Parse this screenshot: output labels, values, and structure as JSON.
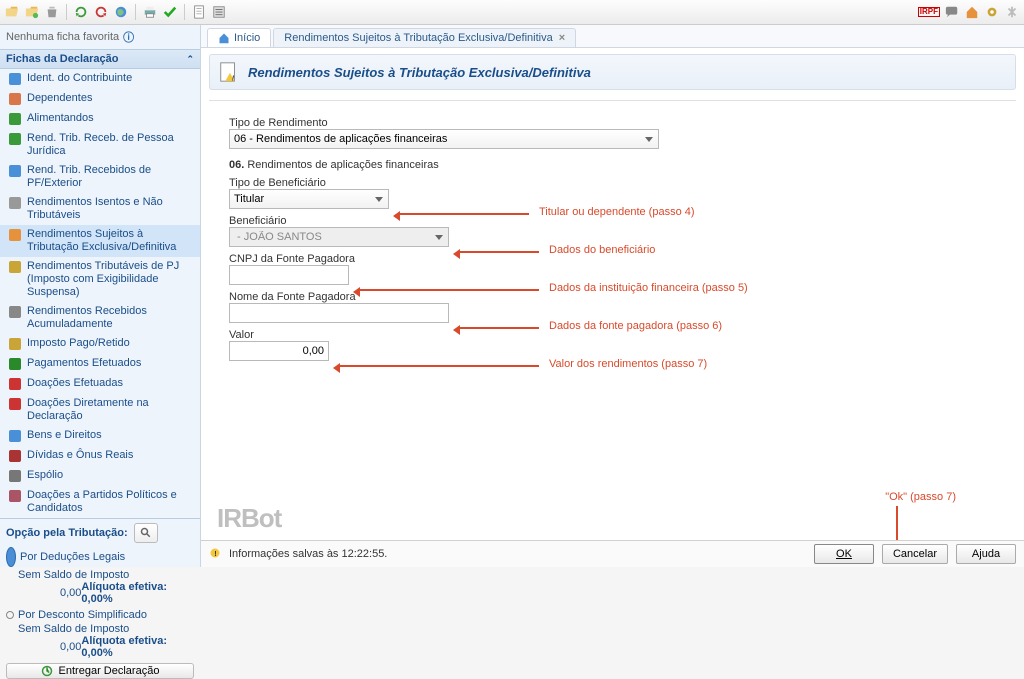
{
  "toolbar_icons": [
    "folder-open-icon",
    "folder-new-icon",
    "trash-icon",
    "refresh-icon",
    "undo-icon",
    "world-icon",
    "print-icon",
    "check-icon",
    "doc-icon",
    "list-icon"
  ],
  "toolbar_right_icons": [
    "irpf-icon",
    "chat-icon",
    "home-icon",
    "gear-icon",
    "pin-icon"
  ],
  "favorites_text": "Nenhuma ficha favorita",
  "section_title": "Fichas da Declaração",
  "tree": [
    {
      "label": "Ident. do Contribuinte",
      "icon": "person-icon"
    },
    {
      "label": "Dependentes",
      "icon": "people-icon"
    },
    {
      "label": "Alimentandos",
      "icon": "meal-icon"
    },
    {
      "label": "Rend. Trib. Receb. de Pessoa Jurídica",
      "icon": "doc-green-icon"
    },
    {
      "label": "Rend. Trib. Recebidos de PF/Exterior",
      "icon": "doc-blue-icon"
    },
    {
      "label": "Rendimentos Isentos e Não Tributáveis",
      "icon": "doc-gray-icon"
    },
    {
      "label": "Rendimentos Sujeitos à Tributação Exclusiva/Definitiva",
      "icon": "doc-orange-icon",
      "active": true
    },
    {
      "label": "Rendimentos Tributáveis de PJ (Imposto com Exigibilidade Suspensa)",
      "icon": "doc-plus-icon"
    },
    {
      "label": "Rendimentos Recebidos Acumuladamente",
      "icon": "doc-stack-icon"
    },
    {
      "label": "Imposto Pago/Retido",
      "icon": "coin-icon"
    },
    {
      "label": "Pagamentos Efetuados",
      "icon": "money-icon"
    },
    {
      "label": "Doações Efetuadas",
      "icon": "gift-icon"
    },
    {
      "label": "Doações Diretamente na Declaração",
      "icon": "heart-icon"
    },
    {
      "label": "Bens e Direitos",
      "icon": "house-icon"
    },
    {
      "label": "Dívidas e Ônus Reais",
      "icon": "debt-icon"
    },
    {
      "label": "Espólio",
      "icon": "estate-icon"
    },
    {
      "label": "Doações a Partidos Políticos e Candidatos",
      "icon": "vote-icon"
    }
  ],
  "opcao": {
    "title": "Opção pela Tributação:",
    "opt1": {
      "label": "Por Deduções Legais",
      "sub": "Sem Saldo de Imposto",
      "value": "0,00",
      "aliq": "Alíquota efetiva: 0,00%",
      "selected": true
    },
    "opt2": {
      "label": "Por Desconto Simplificado",
      "sub": "Sem Saldo de Imposto",
      "value": "0,00",
      "aliq": "Alíquota efetiva: 0,00%",
      "selected": false
    }
  },
  "entregar_label": "Entregar Declaração",
  "tabs": {
    "home": "Início",
    "current": "Rendimentos Sujeitos à Tributação Exclusiva/Definitiva"
  },
  "page_title": "Rendimentos Sujeitos à Tributação Exclusiva/Definitiva",
  "form": {
    "tipo_rend_label": "Tipo de Rendimento",
    "tipo_rend_value": "06 - Rendimentos de aplicações financeiras",
    "sub_title_num": "06.",
    "sub_title_text": "Rendimentos de aplicações financeiras",
    "tipo_benef_label": "Tipo de Beneficiário",
    "tipo_benef_value": "Titular",
    "benef_label": "Beneficiário",
    "benef_value": " - JOÃO SANTOS",
    "cnpj_label": "CNPJ da Fonte Pagadora",
    "cnpj_value": "",
    "nome_fonte_label": "Nome da Fonte Pagadora",
    "nome_fonte_value": "",
    "valor_label": "Valor",
    "valor_value": "0,00"
  },
  "annots": {
    "a1": "Titular ou dependente (passo 4)",
    "a2": "Dados do beneficiário",
    "a3": "Dados da instituição financeira (passo 5)",
    "a4": "Dados da fonte pagadora (passo 6)",
    "a5": "Valor dos rendimentos (passo 7)",
    "a_ok": "\"Ok\" (passo 7)"
  },
  "watermark": "IRBot",
  "footer": {
    "status": "Informações salvas às 12:22:55.",
    "ok": "OK",
    "cancel": "Cancelar",
    "help": "Ajuda"
  }
}
